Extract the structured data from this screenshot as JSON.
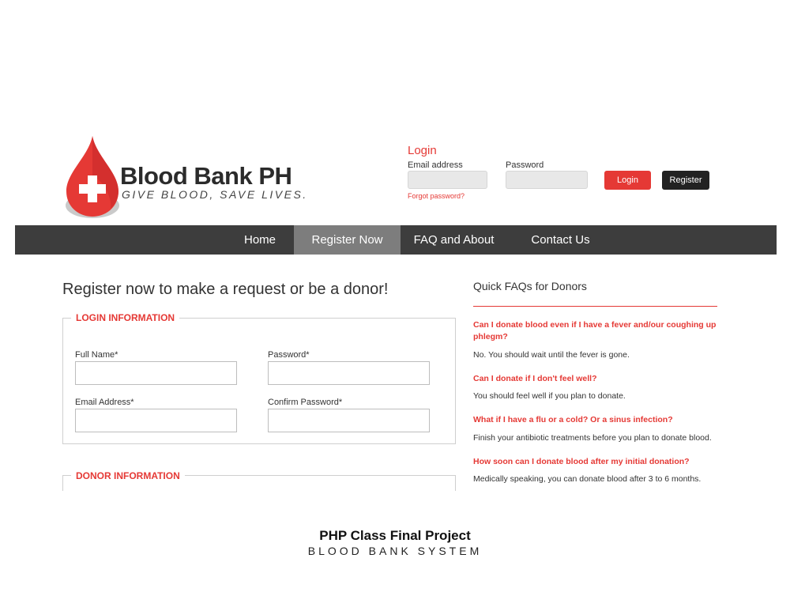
{
  "brand": {
    "name": "Blood Bank PH",
    "tagline": "GIVE BLOOD, SAVE LIVES.",
    "colors": {
      "accent": "#e53935",
      "dark": "#3d3d3d",
      "nav_active": "#7d7d7d"
    }
  },
  "login": {
    "title": "Login",
    "email_label": "Email address",
    "password_label": "Password",
    "email_value": "",
    "password_value": "",
    "forgot_link": "Forgot password?",
    "login_button": "Login",
    "register_button": "Register"
  },
  "nav": {
    "items": [
      {
        "label": "Home",
        "active": false
      },
      {
        "label": "Register Now",
        "active": true
      },
      {
        "label": "FAQ and About",
        "active": false
      },
      {
        "label": "Contact Us",
        "active": false
      }
    ]
  },
  "main": {
    "heading": "Register now to make a request or be a donor!",
    "login_info": {
      "legend": "LOGIN INFORMATION",
      "fields": [
        {
          "label": "Full Name*",
          "value": ""
        },
        {
          "label": "Password*",
          "value": ""
        },
        {
          "label": "Email Address*",
          "value": ""
        },
        {
          "label": "Confirm Password*",
          "value": ""
        }
      ]
    },
    "donor_info": {
      "legend": "DONOR INFORMATION"
    }
  },
  "faq": {
    "title": "Quick FAQs for Donors",
    "items": [
      {
        "q": "Can I donate blood even if I have a fever and/our coughing up phlegm?",
        "a": "No. You should wait until the fever is gone."
      },
      {
        "q": "Can I donate if I don't feel well?",
        "a": "You should feel well if you plan to donate."
      },
      {
        "q": "What if I have a flu or a cold? Or a sinus infection?",
        "a": "Finish your antibiotic treatments before you plan to donate blood."
      },
      {
        "q": "How soon can I donate blood after my initial donation?",
        "a": "Medically speaking, you can donate blood after 3 to 6 months."
      }
    ]
  },
  "caption": {
    "title": "PHP Class Final Project",
    "subtitle": "BLOOD BANK SYSTEM"
  },
  "icons": {
    "logo": "blood-drop-cross-icon"
  }
}
